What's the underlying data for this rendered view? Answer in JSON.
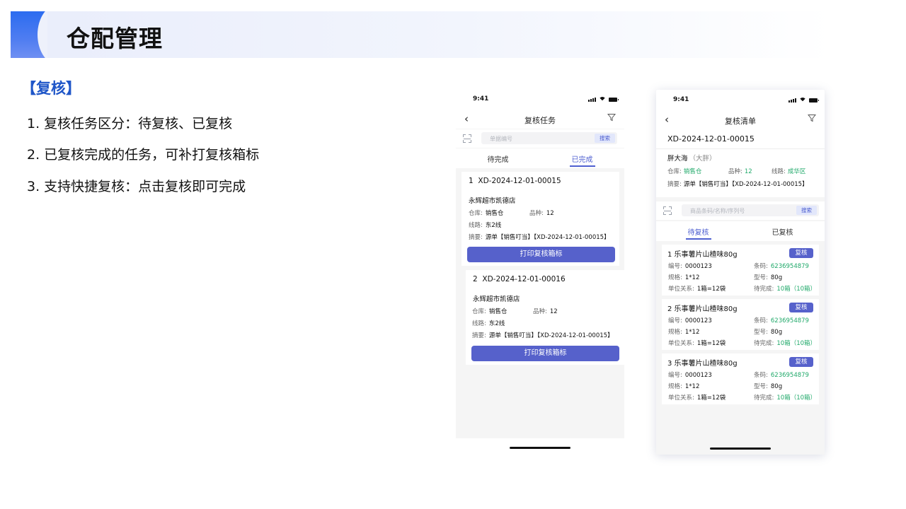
{
  "slide": {
    "title": "仓配管理",
    "section": "【复核】",
    "points": [
      {
        "num": "1.",
        "text": "复核任务区分：待复核、已复核"
      },
      {
        "num": "2.",
        "text": "已复核完成的任务，可补打复核箱标"
      },
      {
        "num": "3.",
        "text": "支持快捷复核：点击复核即可完成"
      }
    ]
  },
  "phone1": {
    "time": "9:41",
    "title": "复核任务",
    "search_placeholder": "单据编号",
    "search_button": "搜索",
    "tabs": [
      "待完成",
      "已完成"
    ],
    "active_tab": "已完成",
    "tasks": [
      {
        "index": "1",
        "order": "XD-2024-12-01-00015",
        "store": "永辉超市凯德店",
        "warehouse_label": "仓库:",
        "warehouse": "销售仓",
        "sku_label": "品种:",
        "sku": "12",
        "route_label": "线路:",
        "route": "东2线",
        "summary_label": "摘要:",
        "summary": "源单【销售叮当】【XD-2024-12-01-00015】",
        "print_button": "打印复核箱标"
      },
      {
        "index": "2",
        "order": "XD-2024-12-01-00016",
        "store": "永辉超市凯德店",
        "warehouse_label": "仓库:",
        "warehouse": "销售仓",
        "sku_label": "品种:",
        "sku": "12",
        "route_label": "线路:",
        "route": "东2线",
        "summary_label": "摘要:",
        "summary": "源单【销售叮当】【XD-2024-12-01-00015】",
        "print_button": "打印复核箱标"
      }
    ]
  },
  "phone2": {
    "time": "9:41",
    "title": "复核清单",
    "order": "XD-2024-12-01-00015",
    "customer": "胖大海",
    "customer_nick": "（大胖）",
    "warehouse_label": "仓库:",
    "warehouse": "销售仓",
    "sku_label": "品种:",
    "sku": "12",
    "route_label": "线路:",
    "route": "成华区",
    "summary_label": "摘要:",
    "summary": "源单【销售叮当】【XD-2024-12-01-00015】",
    "search_placeholder": "商品条码/名称/序列号",
    "search_button": "搜索",
    "tabs": [
      "待复核",
      "已复核"
    ],
    "active_tab": "待复核",
    "items": [
      {
        "name": "1 乐事薯片山楂味80g",
        "action": "复核",
        "code_label": "编号:",
        "code": "0000123",
        "barcode_label": "条码:",
        "barcode": "6236954879",
        "spec_label": "规格:",
        "spec": "1*12",
        "model_label": "型号:",
        "model": "80g",
        "unit_label": "单位关系:",
        "unit": "1箱=12袋",
        "pending_label": "待完成:",
        "pending": "10箱（10箱）"
      },
      {
        "name": "2  乐事薯片山楂味80g",
        "action": "复核",
        "code_label": "编号:",
        "code": "0000123",
        "barcode_label": "条码:",
        "barcode": "6236954879",
        "spec_label": "规格:",
        "spec": "1*12",
        "model_label": "型号:",
        "model": "80g",
        "unit_label": "单位关系:",
        "unit": "1箱=12袋",
        "pending_label": "待完成:",
        "pending": "10箱（10箱）"
      },
      {
        "name": "3  乐事薯片山楂味80g",
        "action": "复核",
        "code_label": "编号:",
        "code": "0000123",
        "barcode_label": "条码:",
        "barcode": "6236954879",
        "spec_label": "规格:",
        "spec": "1*12",
        "model_label": "型号:",
        "model": "80g",
        "unit_label": "单位关系:",
        "unit": "1箱=12袋",
        "pending_label": "待完成:",
        "pending": "10箱（10箱）"
      }
    ]
  },
  "icons": [
    "back-chevron-icon",
    "filter-icon",
    "scan-icon",
    "signal-icon",
    "wifi-icon",
    "battery-icon"
  ],
  "colors": {
    "accent": "#5661cb",
    "title_blue": "#1f56c8",
    "green": "#20a96a",
    "tab_active": "#4e5fd0"
  }
}
